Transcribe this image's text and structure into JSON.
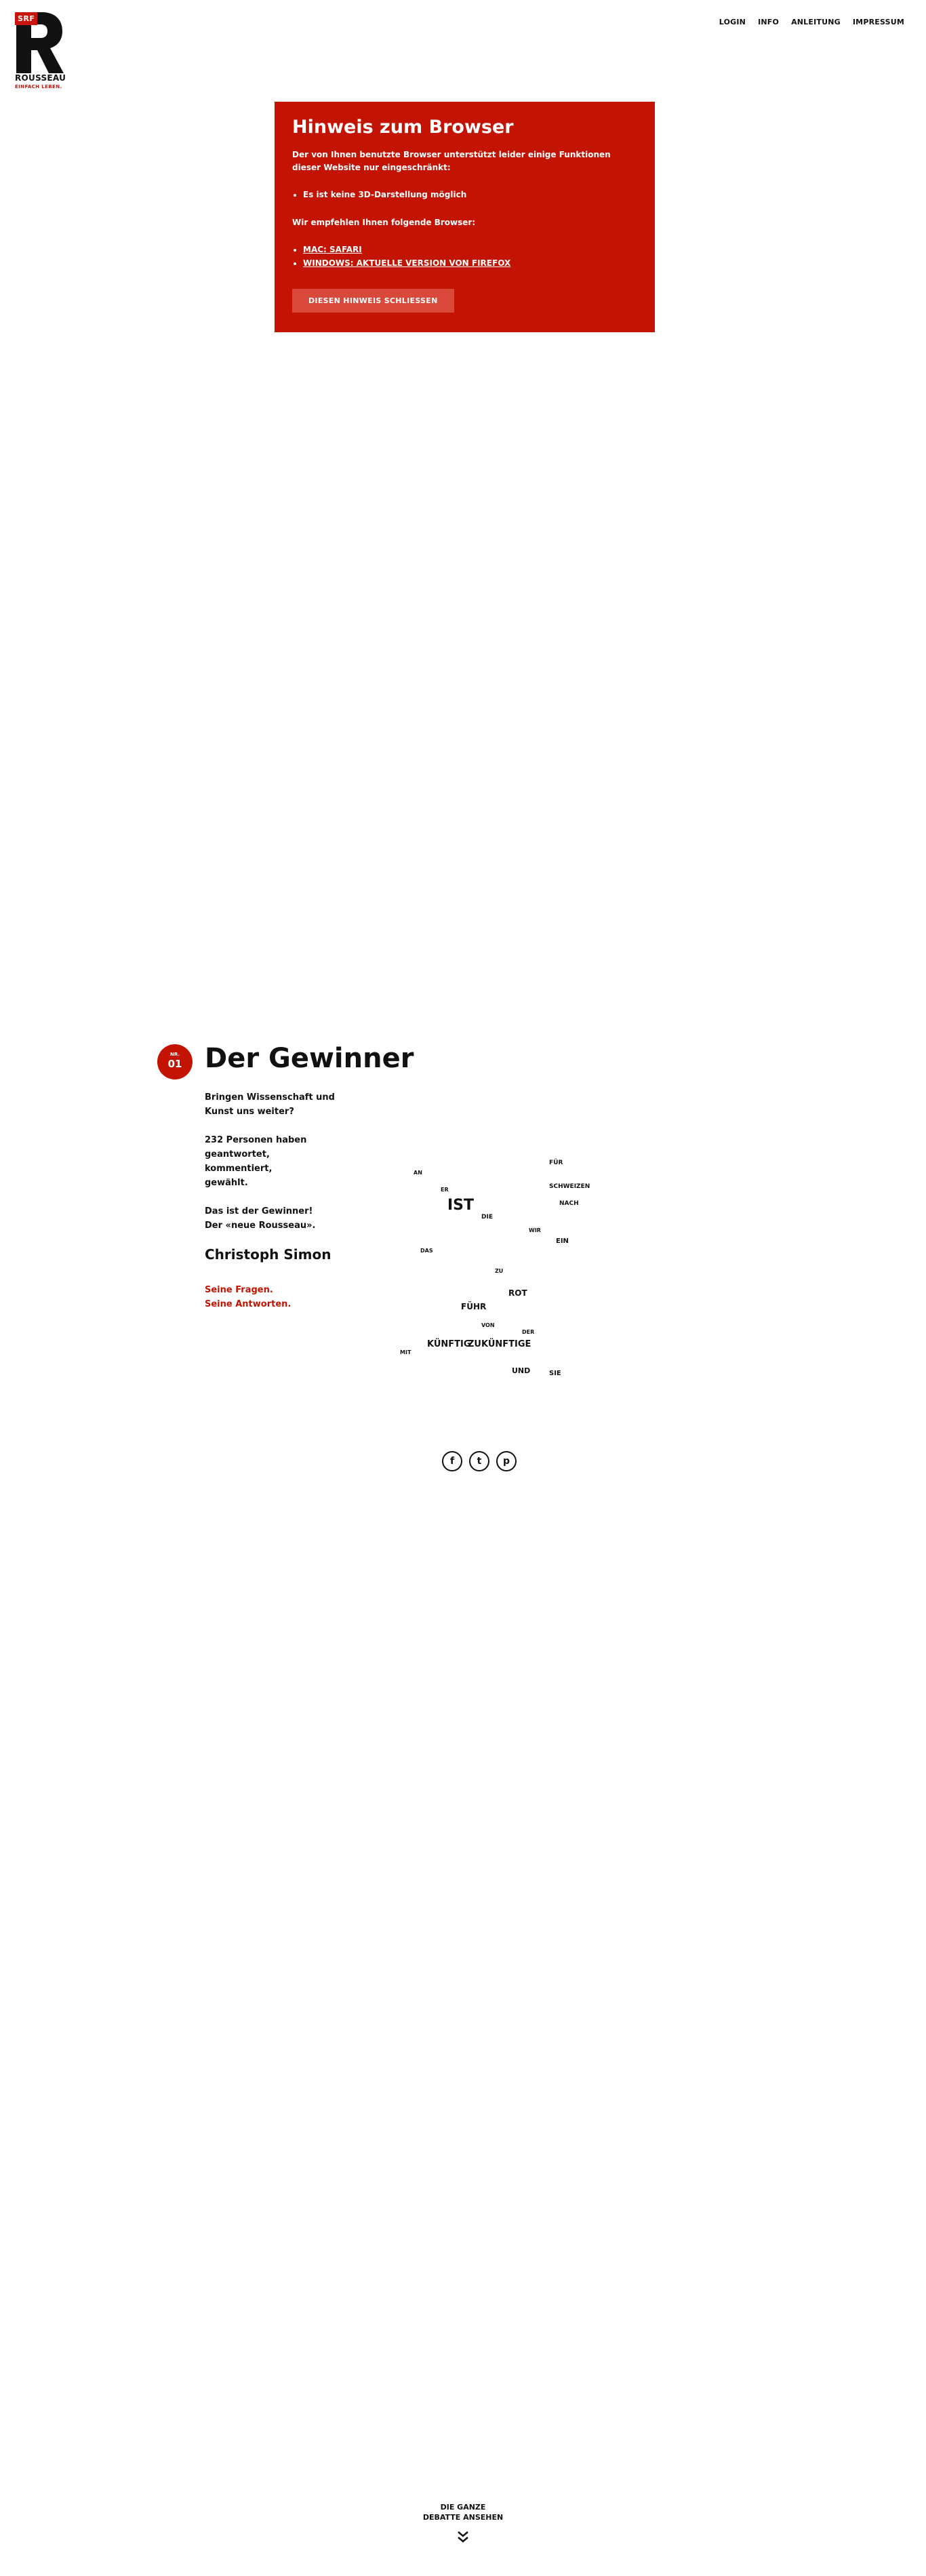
{
  "logo": {
    "badge": "SRF",
    "brand": "ROUSSEAU",
    "tagline": "EINFACH LEBEN."
  },
  "nav": [
    {
      "label": "LOGIN"
    },
    {
      "label": "INFO"
    },
    {
      "label": "ANLEITUNG"
    },
    {
      "label": "IMPRESSUM"
    }
  ],
  "notice": {
    "title": "Hinweis zum Browser",
    "text": "Der von Ihnen benutzte Browser unterstützt leider einige Funktionen dieser Website nur eingeschränkt:",
    "limitations": [
      "Es ist keine 3D-Darstellung möglich"
    ],
    "recommend": "Wir empfehlen Ihnen folgende Browser:",
    "browsers": [
      "MAC: SAFARI",
      "WINDOWS: AKTUELLE VERSION VON FIREFOX"
    ],
    "close_label": "DIESEN HINWEIS SCHLIESSEN"
  },
  "winner": {
    "badge_small": "NR.",
    "badge_num": "01",
    "title": "Der Gewinner",
    "question_1": "Bringen Wissenschaft und",
    "question_2": "Kunst uns weiter?",
    "stats_1": "232 Personen haben",
    "stats_2": "geantwortet,",
    "stats_3": "kommentiert,",
    "stats_4": "gewählt.",
    "announce_1": "Das ist der Gewinner!",
    "announce_2": "Der «neue Rousseau».",
    "name": "Christoph Simon",
    "link_questions": "Seine Fragen.",
    "link_answers": "Seine Antworten."
  },
  "wordcloud": {
    "words": [
      {
        "text": "IST"
      },
      {
        "text": "KÜNFTIG"
      },
      {
        "text": "ZUKÜNFTIGE"
      },
      {
        "text": "ROT"
      },
      {
        "text": "FÜR"
      },
      {
        "text": "SCHWEIZEN"
      },
      {
        "text": "NACH"
      },
      {
        "text": "UND"
      },
      {
        "text": "SIE"
      },
      {
        "text": "FÜHR"
      },
      {
        "text": "AN"
      },
      {
        "text": "DIE"
      },
      {
        "text": "ER"
      },
      {
        "text": "DAS"
      },
      {
        "text": "EIN"
      },
      {
        "text": "WIR"
      },
      {
        "text": "ZU"
      },
      {
        "text": "MIT"
      },
      {
        "text": "VON"
      },
      {
        "text": "DER"
      }
    ]
  },
  "share": {
    "facebook": "f",
    "twitter": "t",
    "pinterest": "p"
  },
  "debate": {
    "line1": "DIE GANZE",
    "line2": "DEBATTE ANSEHEN"
  }
}
